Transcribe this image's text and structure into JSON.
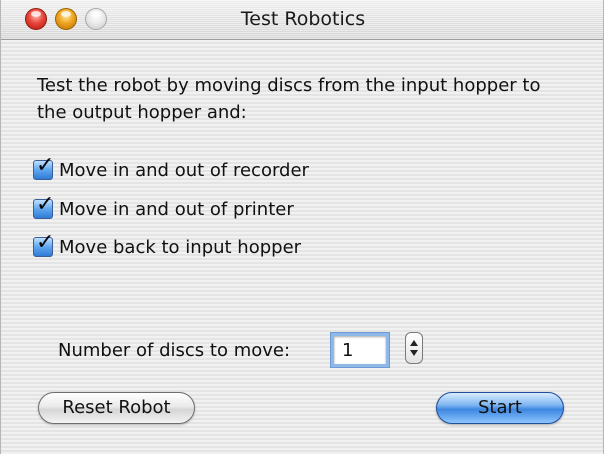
{
  "window": {
    "title": "Test Robotics",
    "controls": [
      "close-button",
      "minimize-button",
      "zoom-button"
    ]
  },
  "description": "Test the robot by moving discs from the input hopper to the output hopper and:",
  "options": [
    {
      "label": "Move in and out of recorder",
      "checked": true
    },
    {
      "label": "Move in and out of printer",
      "checked": true
    },
    {
      "label": "Move back to input hopper",
      "checked": true
    }
  ],
  "discs": {
    "label": "Number of discs to move:",
    "value": "1"
  },
  "buttons": {
    "reset_label": "Reset Robot",
    "start_label": "Start"
  },
  "colors": {
    "accent": "#3e87e0",
    "close": "#e8463a",
    "minimize": "#f0a621"
  }
}
